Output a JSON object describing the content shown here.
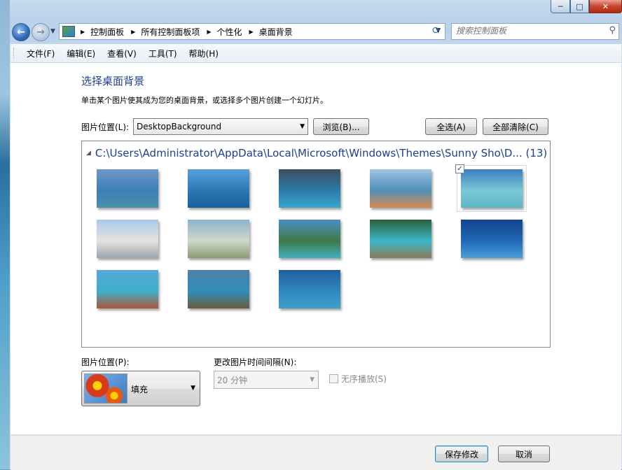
{
  "window": {
    "breadcrumbs": [
      "控制面板",
      "所有控制面板项",
      "个性化",
      "桌面背景"
    ],
    "search_placeholder": "搜索控制面板"
  },
  "caption_buttons": {
    "minimize": "─",
    "maximize": "□",
    "close": "✕"
  },
  "menu": [
    "文件(F)",
    "编辑(E)",
    "查看(V)",
    "工具(T)",
    "帮助(H)"
  ],
  "main": {
    "title": "选择桌面背景",
    "description": "单击某个图片使其成为您的桌面背景，或选择多个图片创建一个幻灯片。",
    "picture_location_label": "图片位置(L):",
    "picture_location_value": "DesktopBackground",
    "browse_button": "浏览(B)...",
    "select_all_button": "全选(A)",
    "clear_all_button": "全部清除(C)",
    "group_header": "C:\\Users\\Administrator\\AppData\\Local\\Microsoft\\Windows\\Themes\\Sunny Sho\\D... (13)",
    "thumbnails": [
      {
        "name": "thumb-1",
        "checked": false,
        "colors": [
          "#6f97c9",
          "#3a7fb8",
          "#4f8fa8"
        ]
      },
      {
        "name": "thumb-2",
        "checked": false,
        "colors": [
          "#5aa0d8",
          "#2a79b5",
          "#1b5f99"
        ]
      },
      {
        "name": "thumb-3",
        "checked": false,
        "colors": [
          "#3b4f5e",
          "#2a7aa8",
          "#38a7cf"
        ]
      },
      {
        "name": "thumb-4",
        "checked": false,
        "colors": [
          "#9fc4e4",
          "#4f8fb5",
          "#d88b4f"
        ]
      },
      {
        "name": "thumb-5",
        "checked": true,
        "colors": [
          "#3c7fbf",
          "#79c8d6",
          "#5cb7c2"
        ]
      },
      {
        "name": "thumb-6",
        "checked": false,
        "colors": [
          "#a8c8ea",
          "#e6e3df",
          "#9aa5b0"
        ]
      },
      {
        "name": "thumb-7",
        "checked": false,
        "colors": [
          "#8fb2cd",
          "#cfd8c9",
          "#8a9a74"
        ]
      },
      {
        "name": "thumb-8",
        "checked": false,
        "colors": [
          "#4a8ec6",
          "#3f7a46",
          "#3fb0c0"
        ]
      },
      {
        "name": "thumb-9",
        "checked": false,
        "colors": [
          "#2d5e3a",
          "#3ab8c8",
          "#8a7a5a"
        ]
      },
      {
        "name": "thumb-10",
        "checked": false,
        "colors": [
          "#14428c",
          "#1f68b8",
          "#4aa0d8"
        ]
      },
      {
        "name": "thumb-11",
        "checked": false,
        "colors": [
          "#59a8d8",
          "#3cb0c8",
          "#b0553a"
        ]
      },
      {
        "name": "thumb-12",
        "checked": false,
        "colors": [
          "#4f7fa8",
          "#2e8fb8",
          "#6b5a3e"
        ]
      },
      {
        "name": "thumb-13",
        "checked": false,
        "colors": [
          "#1f5f9c",
          "#2f88c0",
          "#3ba0c8"
        ]
      }
    ]
  },
  "options": {
    "position_label": "图片位置(P):",
    "position_value": "填充",
    "interval_label": "更改图片时间间隔(N):",
    "interval_value": "20 分钟",
    "shuffle_label": "无序播放(S)",
    "shuffle_checked": false
  },
  "footer": {
    "save_button": "保存修改",
    "cancel_button": "取消"
  },
  "colors": {
    "title_blue": "#1e3f8f",
    "window_frame": "#bcd4ec"
  }
}
